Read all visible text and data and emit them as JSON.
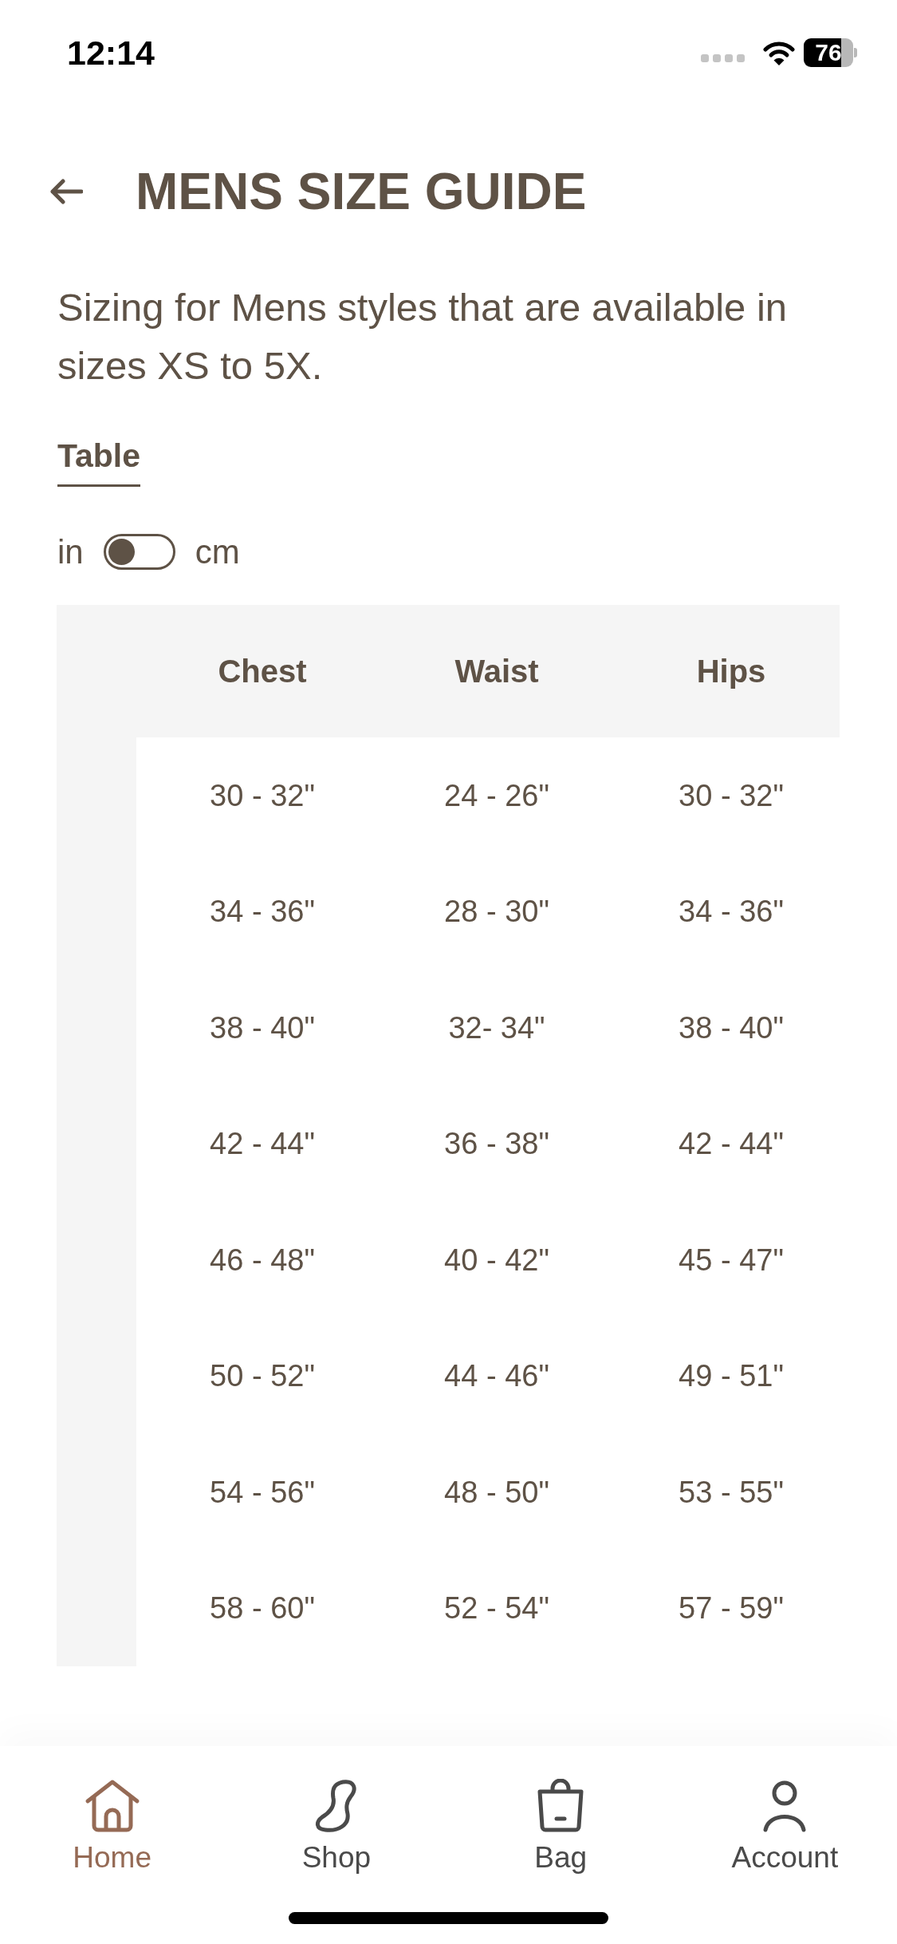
{
  "status_bar": {
    "time": "12:14",
    "battery": "76"
  },
  "header": {
    "title": "MENS SIZE GUIDE"
  },
  "description": "Sizing for Mens styles that are available in sizes XS to 5X.",
  "tabs": [
    {
      "label": "Table",
      "selected": true
    }
  ],
  "unit_toggle": {
    "left_label": "in",
    "right_label": "cm",
    "on": false
  },
  "table": {
    "columns": [
      "Chest",
      "Waist",
      "Hips"
    ],
    "rows": [
      [
        "30 - 32\"",
        "24 - 26\"",
        "30 - 32\""
      ],
      [
        "34 - 36\"",
        "28 - 30\"",
        "34 - 36\""
      ],
      [
        "38 - 40\"",
        "32- 34\"",
        "38 - 40\""
      ],
      [
        "42 - 44\"",
        "36 - 38\"",
        "42 - 44\""
      ],
      [
        "46 - 48\"",
        "40 - 42\"",
        "45 - 47\""
      ],
      [
        "50 - 52\"",
        "44 - 46\"",
        "49 - 51\""
      ],
      [
        "54 - 56\"",
        "48 - 50\"",
        "53 - 55\""
      ],
      [
        "58 - 60\"",
        "52 - 54\"",
        "57 - 59\""
      ]
    ]
  },
  "tab_bar": {
    "items": [
      {
        "label": "Home",
        "selected": true
      },
      {
        "label": "Shop",
        "selected": false
      },
      {
        "label": "Bag",
        "selected": false
      },
      {
        "label": "Account",
        "selected": false
      }
    ]
  }
}
